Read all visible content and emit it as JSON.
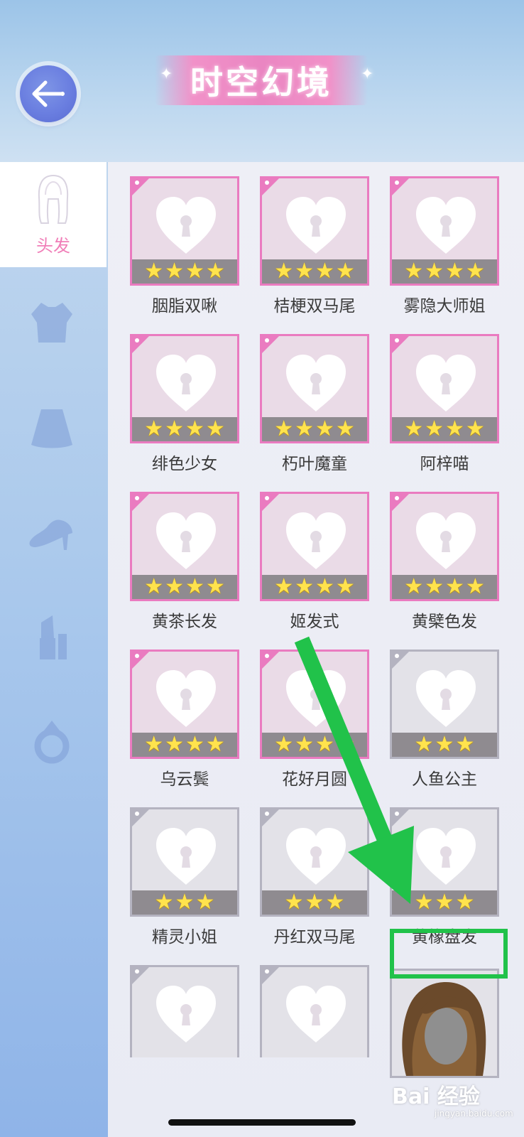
{
  "header": {
    "title": "时空幻境"
  },
  "sidebar": {
    "active_tab": {
      "label": "头发"
    },
    "tabs": [
      {
        "icon": "hair-icon",
        "label": "头发"
      },
      {
        "icon": "top-icon"
      },
      {
        "icon": "skirt-icon"
      },
      {
        "icon": "shoes-icon"
      },
      {
        "icon": "makeup-icon"
      },
      {
        "icon": "ring-icon"
      }
    ]
  },
  "items": [
    {
      "name": "胭脂双啾",
      "stars": 4,
      "rarity": "pink"
    },
    {
      "name": "桔梗双马尾",
      "stars": 4,
      "rarity": "pink"
    },
    {
      "name": "雾隐大师姐",
      "stars": 4,
      "rarity": "pink"
    },
    {
      "name": "绯色少女",
      "stars": 4,
      "rarity": "pink"
    },
    {
      "name": "朽叶魔童",
      "stars": 4,
      "rarity": "pink"
    },
    {
      "name": "阿梓喵",
      "stars": 4,
      "rarity": "pink"
    },
    {
      "name": "黄茶长发",
      "stars": 4,
      "rarity": "pink"
    },
    {
      "name": "姬发式",
      "stars": 4,
      "rarity": "pink"
    },
    {
      "name": "黄檗色发",
      "stars": 4,
      "rarity": "pink"
    },
    {
      "name": "乌云鬓",
      "stars": 4,
      "rarity": "pink"
    },
    {
      "name": "花好月圆",
      "stars": 4,
      "rarity": "pink"
    },
    {
      "name": "人鱼公主",
      "stars": 3,
      "rarity": "gray"
    },
    {
      "name": "精灵小姐",
      "stars": 3,
      "rarity": "gray"
    },
    {
      "name": "丹红双马尾",
      "stars": 3,
      "rarity": "gray"
    },
    {
      "name": "黄橡盘发",
      "stars": 3,
      "rarity": "gray"
    }
  ],
  "colors": {
    "pink_frame": "#ea7bc0",
    "gray_frame": "#b4b3c0",
    "highlight": "#21c24a",
    "star": "#ffe34d"
  },
  "watermark": {
    "text": "Bai 经验",
    "sub": "jingyan.baidu.com"
  }
}
